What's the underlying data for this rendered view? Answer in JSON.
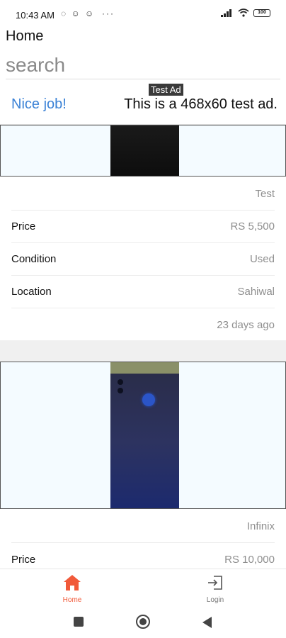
{
  "status_bar": {
    "time": "10:43 AM",
    "notifications": "◌ ☺ ☺",
    "more": "···",
    "battery": "100"
  },
  "app_bar": {
    "title": "Home"
  },
  "search": {
    "placeholder": "search"
  },
  "ad": {
    "badge": "Test Ad",
    "headline": "Nice job!",
    "text": "This is a 468x60 test ad."
  },
  "listings": [
    {
      "title": "Test",
      "rows": [
        {
          "label": "Price",
          "value": "RS 5,500"
        },
        {
          "label": "Condition",
          "value": "Used"
        },
        {
          "label": "Location",
          "value": "Sahiwal"
        }
      ],
      "posted": "23 days ago"
    },
    {
      "title": "Infinix",
      "rows": [
        {
          "label": "Price",
          "value": "RS 10,000"
        }
      ]
    }
  ],
  "bottom_nav": {
    "home_label": "Home",
    "login_label": "Login",
    "active_color": "#f15a3a"
  }
}
